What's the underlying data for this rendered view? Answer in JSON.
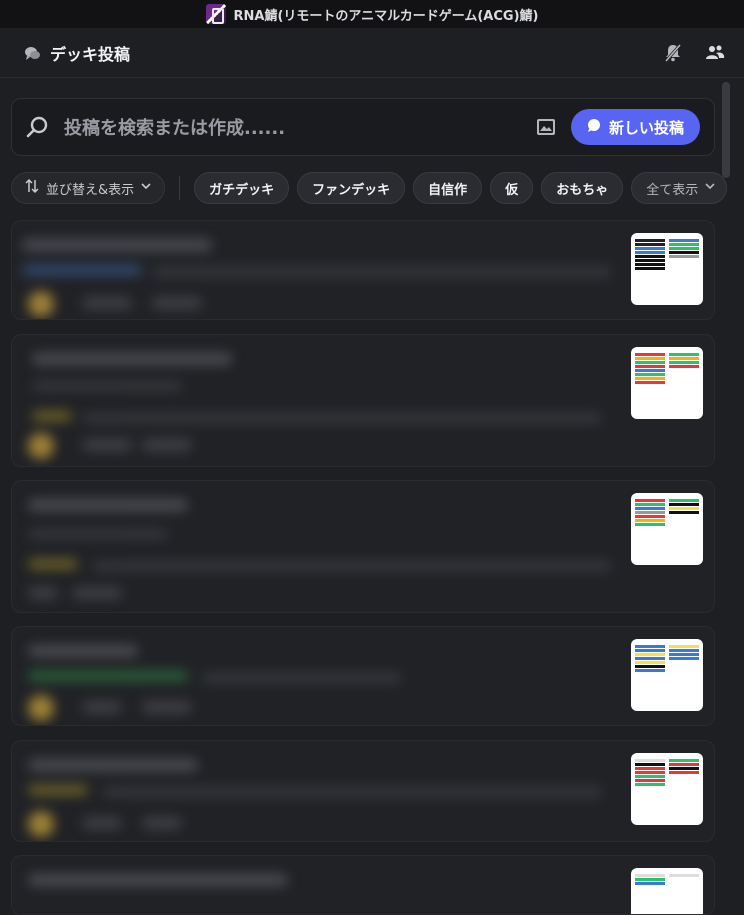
{
  "window": {
    "title": "RNA鯖(リモートのアニマルカードゲーム(ACG)鯖)",
    "server_icon": "server-icon"
  },
  "channel": {
    "title": "デッキ投稿",
    "icon": "forum-icon",
    "header_icons": [
      "mute-notifications-icon",
      "members-icon"
    ]
  },
  "search": {
    "placeholder": "投稿を検索または作成......",
    "new_post_label": "新しい投稿"
  },
  "filters": {
    "sort_label": "並び替え&表示",
    "tags": [
      "ガチデッキ",
      "ファンデッキ",
      "自信作",
      "仮",
      "おもちゃ"
    ],
    "show_all_label": "全て表示"
  },
  "colors": {
    "background": "#1e1f22",
    "accent": "#5865f2",
    "post_card": "#212226"
  }
}
